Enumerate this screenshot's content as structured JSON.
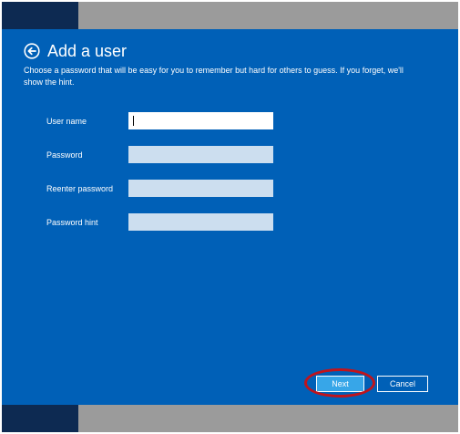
{
  "dialog": {
    "title": "Add a user",
    "description": "Choose a password that will be easy for you to remember but hard for others to guess. If you forget, we'll show the hint.",
    "back_icon": "back-arrow-icon",
    "background_color": "#0060b7"
  },
  "fields": [
    {
      "label": "User name",
      "value": "",
      "placeholder": "",
      "active": true
    },
    {
      "label": "Password",
      "value": "",
      "placeholder": "",
      "active": false
    },
    {
      "label": "Reenter password",
      "value": "",
      "placeholder": "",
      "active": false
    },
    {
      "label": "Password hint",
      "value": "",
      "placeholder": "",
      "active": false
    }
  ],
  "buttons": {
    "next_label": "Next",
    "cancel_label": "Cancel"
  },
  "annotation": {
    "highlight_color": "#c0141c",
    "target": "Next"
  }
}
